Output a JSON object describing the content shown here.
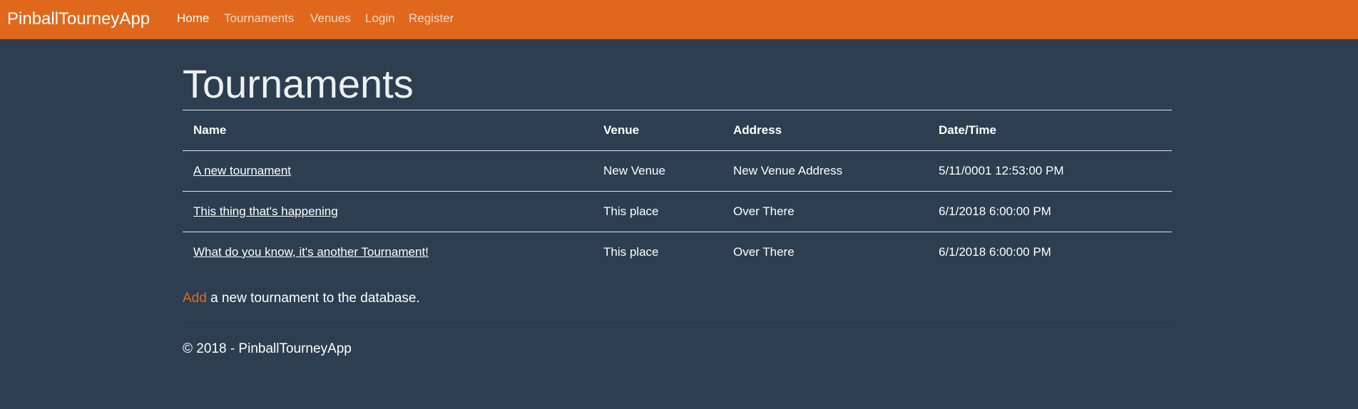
{
  "navbar": {
    "brand": "PinballTourneyApp",
    "links": [
      "Home",
      "Tournaments",
      "Venues",
      "Login",
      "Register"
    ]
  },
  "page": {
    "title": "Tournaments",
    "table": {
      "headers": [
        "Name",
        "Venue",
        "Address",
        "Date/Time"
      ],
      "rows": [
        {
          "name": "A new tournament",
          "venue": "New Venue",
          "address": "New Venue Address",
          "datetime": "5/11/0001 12:53:00 PM"
        },
        {
          "name": "This thing that's happening",
          "venue": "This place",
          "address": "Over There",
          "datetime": "6/1/2018 6:00:00 PM"
        },
        {
          "name": "What do you know, it's another Tournament!",
          "venue": "This place",
          "address": "Over There",
          "datetime": "6/1/2018 6:00:00 PM"
        }
      ]
    },
    "add_link": "Add",
    "add_text": " a new tournament to the database."
  },
  "footer": {
    "text": "© 2018 - PinballTourneyApp"
  },
  "colors": {
    "navbar": "#e0681d",
    "background": "#2c3e50"
  }
}
